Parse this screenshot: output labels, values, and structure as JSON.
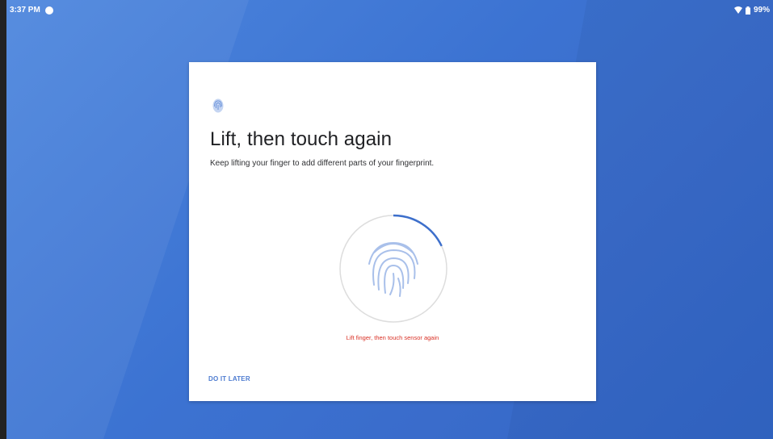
{
  "status_bar": {
    "time": "3:37 PM",
    "battery": "99%"
  },
  "enroll_dialog": {
    "header_icon": "fingerprint-icon",
    "title": "Lift, then touch again",
    "subtitle": "Keep lifting your finger to add different parts of your fingerprint.",
    "sensor_icon": "fingerprint-icon",
    "sensor_status": "Lift finger, then touch sensor again",
    "progress_fraction": 0.18,
    "do_it_later_label": "DO IT LATER"
  },
  "colors": {
    "accent": "#4d7bd0",
    "error": "#d93025",
    "wallpaper": "#3c73d2"
  }
}
